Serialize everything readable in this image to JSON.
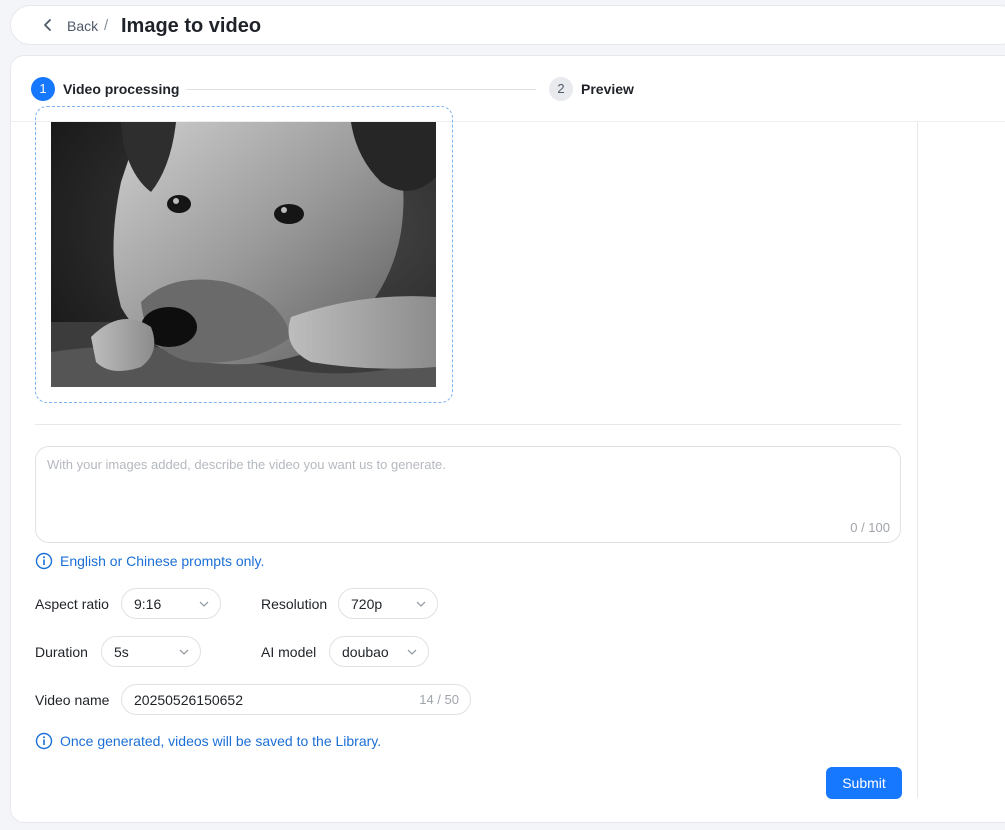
{
  "header": {
    "back_label": "Back",
    "separator": "/",
    "title": "Image to video"
  },
  "steps": [
    {
      "number": "1",
      "label": "Video processing",
      "active": true
    },
    {
      "number": "2",
      "label": "Preview",
      "active": false
    }
  ],
  "upload": {
    "image_alt": "Black and white photo of a dog resting its head on its paws"
  },
  "prompt": {
    "placeholder": "With your images added, describe the video you want us to generate.",
    "value": "",
    "count": "0 / 100"
  },
  "prompt_hint": "English or Chinese prompts only.",
  "settings": {
    "aspect_ratio": {
      "label": "Aspect ratio",
      "value": "9:16"
    },
    "resolution": {
      "label": "Resolution",
      "value": "720p"
    },
    "duration": {
      "label": "Duration",
      "value": "5s"
    },
    "ai_model": {
      "label": "AI model",
      "value": "doubao"
    },
    "video_name": {
      "label": "Video name",
      "value": "20250526150652",
      "count": "14 / 50"
    }
  },
  "save_hint": "Once generated, videos will be saved to the Library.",
  "submit_label": "Submit",
  "colors": {
    "accent": "#1677ff",
    "hint_text": "#1b6fd6",
    "dashed_border": "#7fb2f0"
  }
}
